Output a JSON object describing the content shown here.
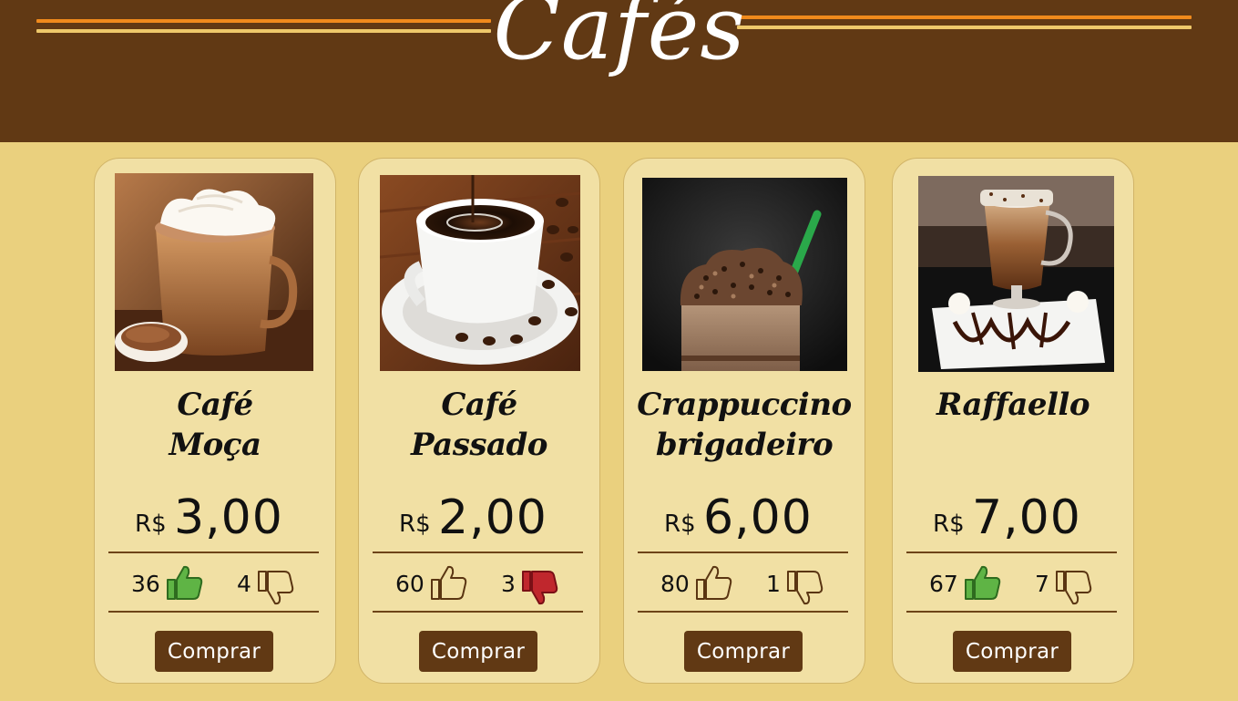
{
  "header": {
    "title": "Cafés"
  },
  "colors": {
    "header_bg": "#613914",
    "page_bg": "#ead07e",
    "card_bg": "#f1e0a4",
    "line_orange": "#f08a1c",
    "line_yellow": "#eec86a",
    "button_bg": "#613914",
    "like_active": "#5fb445",
    "dislike_active": "#c0272d"
  },
  "products": [
    {
      "name_line1": "Café",
      "name_line2": "Moça",
      "currency": "R$",
      "price": "3,00",
      "likes": "36",
      "dislikes": "4",
      "liked": true,
      "disliked": false,
      "image": "mocha-coffee-image",
      "buy_label": "Comprar"
    },
    {
      "name_line1": "Café",
      "name_line2": "Passado",
      "currency": "R$",
      "price": "2,00",
      "likes": "60",
      "dislikes": "3",
      "liked": false,
      "disliked": true,
      "image": "brewed-coffee-image",
      "buy_label": "Comprar"
    },
    {
      "name_line1": "Crappuccino",
      "name_line2": "brigadeiro",
      "currency": "R$",
      "price": "6,00",
      "likes": "80",
      "dislikes": "1",
      "liked": false,
      "disliked": false,
      "image": "frappuccino-image",
      "buy_label": "Comprar"
    },
    {
      "name_line1": "Raffaello",
      "name_line2": "",
      "currency": "R$",
      "price": "7,00",
      "likes": "67",
      "dislikes": "7",
      "liked": true,
      "disliked": false,
      "image": "raffaello-coffee-image",
      "buy_label": "Comprar"
    }
  ]
}
